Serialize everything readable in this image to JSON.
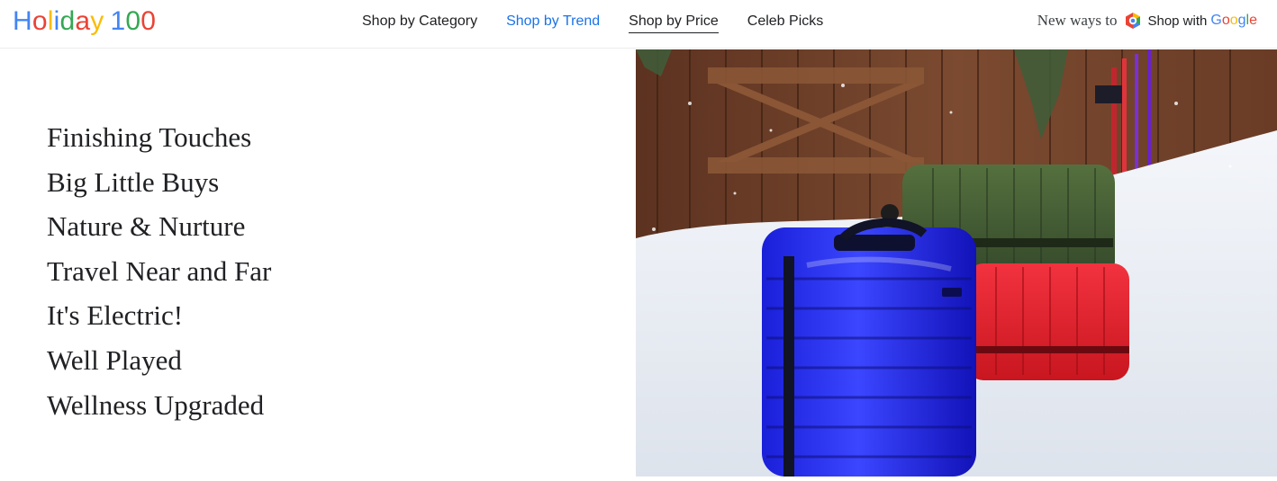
{
  "logo": {
    "letters": [
      {
        "ch": "H",
        "color": "#4285F4"
      },
      {
        "ch": "o",
        "color": "#EA4335"
      },
      {
        "ch": "l",
        "color": "#FBBC04"
      },
      {
        "ch": "i",
        "color": "#4285F4"
      },
      {
        "ch": "d",
        "color": "#34A853"
      },
      {
        "ch": "a",
        "color": "#EA4335"
      },
      {
        "ch": "y",
        "color": "#FBBC04"
      },
      {
        "ch": " ",
        "color": "#4285F4"
      },
      {
        "ch": "1",
        "color": "#4285F4"
      },
      {
        "ch": "0",
        "color": "#34A853"
      },
      {
        "ch": "0",
        "color": "#EA4335"
      }
    ]
  },
  "nav": {
    "items": [
      {
        "label": "Shop by Category"
      },
      {
        "label": "Shop by Trend"
      },
      {
        "label": "Shop by Price"
      },
      {
        "label": "Celeb Picks"
      }
    ]
  },
  "promo": {
    "prefix": "New ways to",
    "icon": "google-lens-icon",
    "shop": "Shop with",
    "google_letters": [
      {
        "ch": "G",
        "color": "#4285F4"
      },
      {
        "ch": "o",
        "color": "#EA4335"
      },
      {
        "ch": "o",
        "color": "#FBBC04"
      },
      {
        "ch": "g",
        "color": "#4285F4"
      },
      {
        "ch": "l",
        "color": "#34A853"
      },
      {
        "ch": "e",
        "color": "#EA4335"
      }
    ]
  },
  "categories": [
    {
      "label": "Finishing Touches"
    },
    {
      "label": "Big Little Buys"
    },
    {
      "label": "Nature & Nurture"
    },
    {
      "label": "Travel Near and Far"
    },
    {
      "label": "It's Electric!"
    },
    {
      "label": "Well Played"
    },
    {
      "label": "Wellness Upgraded"
    }
  ],
  "hero": {
    "subject": "luggage-in-snow-photo"
  },
  "colors": {
    "accent": "#1a73e8",
    "text": "#202124"
  }
}
